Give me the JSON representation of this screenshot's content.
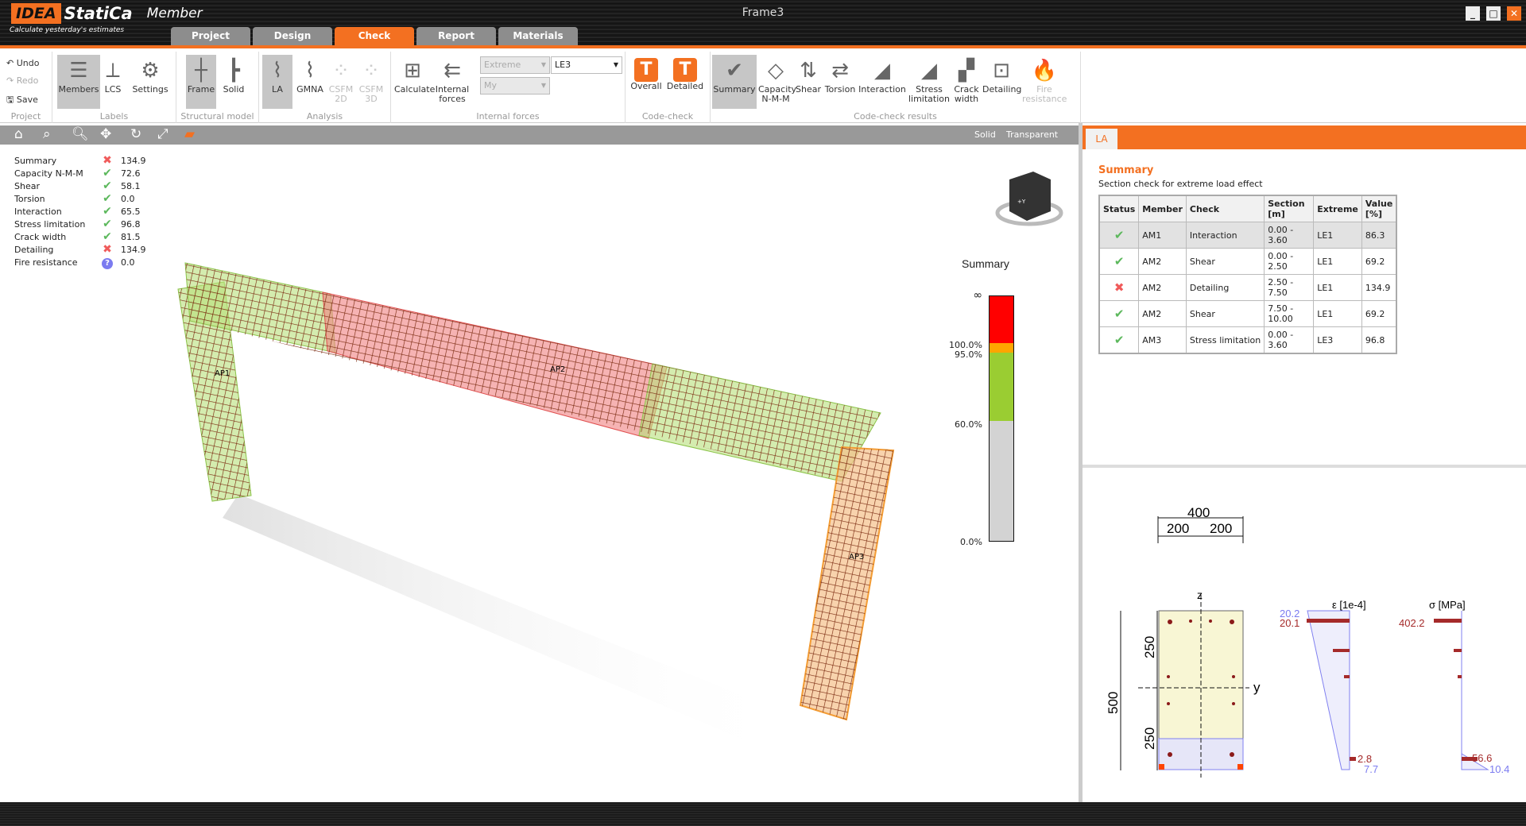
{
  "app": {
    "logo": "IDEA",
    "brand": "StatiCa",
    "product": "Member",
    "tagline": "Calculate yesterday's estimates",
    "title": "Frame3"
  },
  "tabs": [
    "Project",
    "Design",
    "Check",
    "Report",
    "Materials"
  ],
  "ribbon": {
    "project": {
      "label": "Project",
      "undo": "Undo",
      "redo": "Redo",
      "save": "Save"
    },
    "labels": {
      "label": "Labels",
      "members": "Members",
      "lcs": "LCS",
      "settings": "Settings"
    },
    "structural": {
      "label": "Structural model",
      "frame": "Frame",
      "solid": "Solid"
    },
    "analysis": {
      "label": "Analysis",
      "la": "LA",
      "gmna": "GMNA",
      "csfm2d": "CSFM 2D",
      "csfm3d": "CSFM 3D"
    },
    "internal": {
      "label": "Internal forces",
      "calculate": "Calculate",
      "internal_forces": "Internal forces",
      "extreme": "Extreme",
      "le": "LE3",
      "my": "My"
    },
    "codecheck": {
      "label": "Code-check",
      "overall": "Overall",
      "detailed": "Detailed"
    },
    "results": {
      "label": "Code-check results",
      "items": [
        "Summary",
        "Capacity N-M-M",
        "Shear",
        "Torsion",
        "Interaction",
        "Stress limitation",
        "Crack width",
        "Detailing",
        "Fire resistance"
      ]
    }
  },
  "viewtool": {
    "solid": "Solid",
    "transparent": "Transparent"
  },
  "results_list": [
    {
      "label": "Summary",
      "status": "fail",
      "value": "134.9"
    },
    {
      "label": "Capacity N-M-M",
      "status": "ok",
      "value": "72.6"
    },
    {
      "label": "Shear",
      "status": "ok",
      "value": "58.1"
    },
    {
      "label": "Torsion",
      "status": "ok",
      "value": "0.0"
    },
    {
      "label": "Interaction",
      "status": "ok",
      "value": "65.5"
    },
    {
      "label": "Stress limitation",
      "status": "ok",
      "value": "96.8"
    },
    {
      "label": "Crack width",
      "status": "ok",
      "value": "81.5"
    },
    {
      "label": "Detailing",
      "status": "fail",
      "value": "134.9"
    },
    {
      "label": "Fire resistance",
      "status": "unknown",
      "value": "0.0"
    }
  ],
  "model": {
    "labels": [
      "AP1",
      "AP2",
      "AP3"
    ]
  },
  "legend": {
    "title": "Summary",
    "ticks": [
      "∞",
      "100.0%",
      "95.0%",
      "60.0%",
      "0.0%"
    ],
    "colors": {
      "fail": "#ff0000",
      "warn": "#ffa500",
      "ok": "#9acd32",
      "low": "#d3d3d3"
    }
  },
  "panel": {
    "tab": "LA",
    "title": "Summary",
    "subtitle": "Section check for extreme load effect",
    "headers": [
      "Status",
      "Member",
      "Check",
      "Section [m]",
      "Extreme",
      "Value [%]"
    ],
    "rows": [
      {
        "status": "ok",
        "member": "AM1",
        "check": "Interaction",
        "section": "0.00 - 3.60",
        "extreme": "LE1",
        "value": "86.3"
      },
      {
        "status": "ok",
        "member": "AM2",
        "check": "Shear",
        "section": "0.00 - 2.50",
        "extreme": "LE1",
        "value": "69.2"
      },
      {
        "status": "fail",
        "member": "AM2",
        "check": "Detailing",
        "section": "2.50 - 7.50",
        "extreme": "LE1",
        "value": "134.9"
      },
      {
        "status": "ok",
        "member": "AM2",
        "check": "Shear",
        "section": "7.50 - 10.00",
        "extreme": "LE1",
        "value": "69.2"
      },
      {
        "status": "ok",
        "member": "AM3",
        "check": "Stress limitation",
        "section": "0.00 - 3.60",
        "extreme": "LE3",
        "value": "96.8"
      }
    ]
  },
  "section": {
    "width": "400",
    "half1": "200",
    "half2": "200",
    "height": "500",
    "h1": "250",
    "h2": "250",
    "z": "z",
    "y": "y",
    "strain": {
      "title": "ε [1e-4]",
      "top_conc": "20.2",
      "top_steel": "20.1",
      "bot_steel": "2.8",
      "bot_conc": "7.7"
    },
    "stress": {
      "title": "σ [MPa]",
      "top_steel": "402.2",
      "bot_steel": "56.6",
      "bot_conc": "10.4"
    }
  },
  "accent": "#f37021"
}
